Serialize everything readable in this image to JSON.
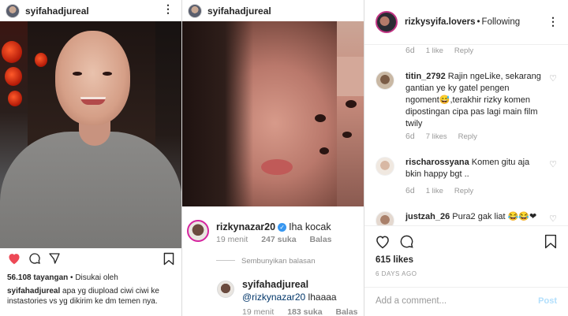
{
  "panel1": {
    "username": "syifahadjureal",
    "views": "56.108 tayangan",
    "liked_by": " • Disukai oleh",
    "caption_user": "syifahadjureal",
    "caption_text": " apa yg diupload ciwi ciwi ke instastories vs yg dikirim ke dm temen nya."
  },
  "panel2": {
    "username": "syifahadjureal",
    "comment1": {
      "user": "rizkynazar20",
      "verified_mark": "✓",
      "text": "Iha kocak",
      "time": "19 menit",
      "likes": "247 suka",
      "reply": "Balas"
    },
    "hide_replies": "Sembunyikan balasan",
    "reply1": {
      "user": "syifahadjureal",
      "mention": "@rizkynazar20",
      "text": " lhaaaa",
      "time": "19 menit",
      "likes": "183 suka",
      "reply": "Balas"
    }
  },
  "panel3": {
    "username": "rizkysyifa.lovers",
    "separator": "•",
    "following": "Following",
    "top_meta": {
      "age": "6d",
      "likes": "1 like",
      "reply": "Reply"
    },
    "comments": [
      {
        "user": "titin_2792",
        "text": " Rajin ngeLike, sekarang gantian ye ky gatel pengen ngoment😅,terakhir rizky komen dipostingan cipa pas lagi main film twily",
        "age": "6d",
        "likes": "7 likes",
        "reply": "Reply"
      },
      {
        "user": "rischarossyana",
        "text": " Komen gitu aja bkin happy bgt ..",
        "age": "6d",
        "likes": "1 like",
        "reply": "Reply"
      },
      {
        "user": "justzah_26",
        "text": " Pura2 gak liat 😂😂❤",
        "age": "",
        "likes": "",
        "reply": ""
      }
    ],
    "likes": "615 likes",
    "posted": "6 DAYS AGO",
    "add_comment_placeholder": "Add a comment...",
    "post_label": "Post"
  },
  "colors": {
    "like_red": "#ed4956",
    "link_blue": "#003569",
    "verified": "#3897f0",
    "post_disabled": "#b2dffc"
  },
  "icons": [
    "heart-icon",
    "comment-icon",
    "share-icon",
    "bookmark-icon",
    "more-icon",
    "verified-icon"
  ]
}
